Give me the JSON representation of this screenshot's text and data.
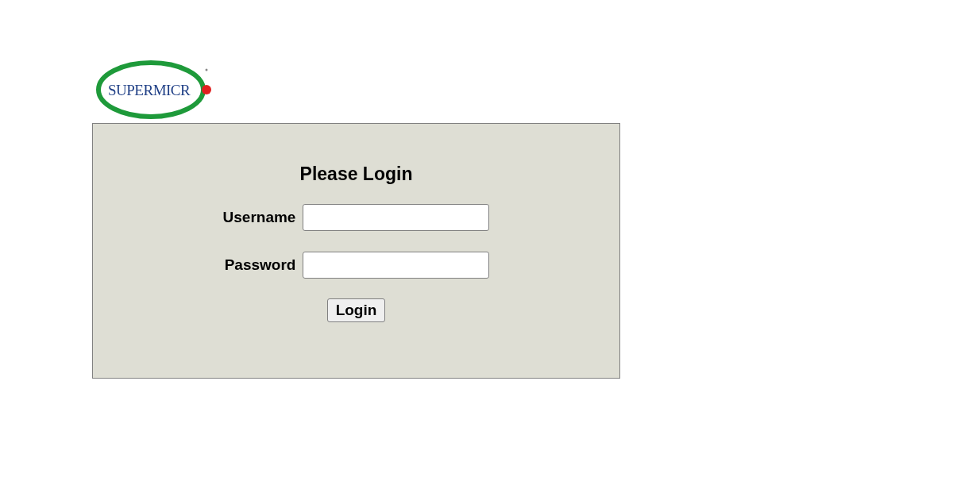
{
  "logo": {
    "text": "SUPERMICR"
  },
  "login": {
    "title": "Please Login",
    "fields": [
      {
        "label": "Username"
      },
      {
        "label": "Password"
      }
    ],
    "button": "Login"
  }
}
